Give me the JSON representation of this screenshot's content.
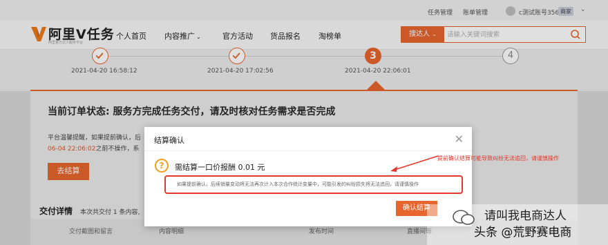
{
  "topbar": {
    "task_manage": "任务管理",
    "billing_manage": "账单管理",
    "account": "c测试账号356",
    "account_badge": "商家"
  },
  "header": {
    "logo_text": "阿里V任务",
    "logo_sub": "阿里官方达人服务平台",
    "nav": [
      "个人首页",
      "内容推广",
      "官方活动",
      "货品报名",
      "淘榜单"
    ],
    "search_type": "搜达人",
    "search_placeholder": "请输入关键词搜索"
  },
  "steps": {
    "items": [
      {
        "state": "done",
        "time": "2021-04-20 16:58:12"
      },
      {
        "state": "done",
        "time": "2021-04-20 17:02:56"
      },
      {
        "state": "current",
        "number": "3",
        "time": "2021-04-20 22:06:01"
      },
      {
        "state": "todo",
        "number": "4",
        "time": ""
      }
    ]
  },
  "order": {
    "status_title": "当前订单状态: 服务方完成任务交付，请及时核对任务需求是否完成",
    "notice": "平台温馨提醒，如果提前确认，后",
    "deadline": "06-04 22:06:02",
    "deadline_suffix": "之前不操作，系",
    "settle_button": "去结算"
  },
  "delivery": {
    "title": "交付详情",
    "subtitle": "本次共交付 1 条内容,",
    "columns": [
      "交付截图和留言",
      "内容明细",
      "发布时间",
      "直播间等"
    ]
  },
  "modal": {
    "title": "结算确认",
    "price_line": "需结算一口价报酬 0.01 元",
    "warning": "如果提前确认，后续销量变动将无法再次计入本次合作统计变量中，可能引发的纠纷损失将无法追回，请谨慎操作",
    "confirm_button": "确认结算"
  },
  "annotation": {
    "text": "提前确认结算可能导致纠纷无法追回，请谨慎操作"
  },
  "watermark": {
    "line1": "请叫我电商达人",
    "line2": "头条 @荒野赛电商"
  },
  "colors": {
    "brand_orange": "#e8652d",
    "annotation_red": "#e3372b",
    "warning_yellow": "#f0a020"
  }
}
